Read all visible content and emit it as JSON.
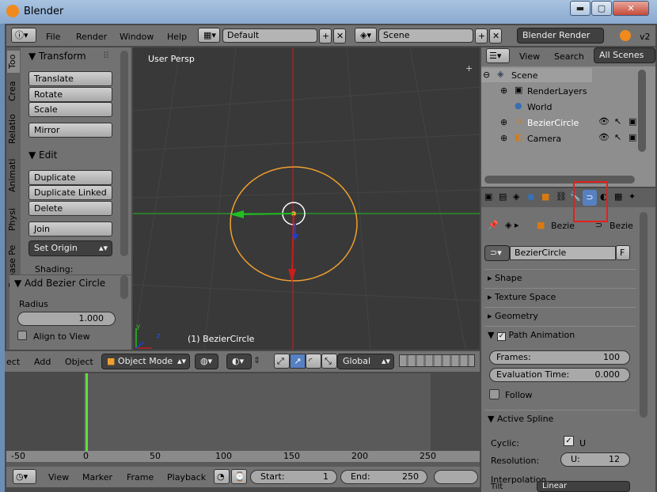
{
  "window": {
    "title": "Blender",
    "min": "▬",
    "max": "▢",
    "close": "✕"
  },
  "infobar": {
    "menus": [
      "File",
      "Render",
      "Window",
      "Help"
    ],
    "layout": "Default",
    "scene": "Scene",
    "engine": "Blender Render",
    "version": "v2"
  },
  "toolshelf": {
    "tabs": [
      "Too",
      "Crea",
      "Relatio",
      "Animati",
      "Physi",
      "Grease Pe"
    ],
    "transform": {
      "title": "Transform",
      "buttons": [
        "Translate",
        "Rotate",
        "Scale",
        "Mirror"
      ]
    },
    "edit": {
      "title": "Edit",
      "buttons": [
        "Duplicate",
        "Duplicate Linked",
        "Delete",
        "Join",
        "Set Origin"
      ],
      "shading": "Shading:"
    }
  },
  "operator": {
    "title": "Add Bezier Circle",
    "radius_label": "Radius",
    "radius_value": "1.000",
    "align": "Align to View"
  },
  "viewport": {
    "label": "User Persp",
    "object": "(1) BezierCircle",
    "axis_y": "y",
    "axis_z": "z"
  },
  "viewheader": {
    "menus": [
      "ect",
      "Add",
      "Object"
    ],
    "mode": "Object Mode",
    "orientation": "Global"
  },
  "timeline": {
    "ticks": [
      "-50",
      "0",
      "50",
      "100",
      "150",
      "200",
      "250"
    ],
    "menus": [
      "View",
      "Marker",
      "Frame",
      "Playback"
    ],
    "start_label": "Start:",
    "start": "1",
    "end_label": "End:",
    "end": "250"
  },
  "outliner": {
    "menus": [
      "View",
      "Search",
      "All Scenes"
    ],
    "items": [
      "Scene",
      "RenderLayers",
      "World",
      "BezierCircle",
      "Camera"
    ]
  },
  "properties": {
    "path1": "Bezie",
    "path2": "Bezie",
    "datablock": "BezierCircle",
    "fake": "F",
    "panels": [
      "Shape",
      "Texture Space",
      "Geometry",
      "Path Animation"
    ],
    "frames_label": "Frames:",
    "frames": "100",
    "eval_label": "Evaluation Time:",
    "eval": "0.000",
    "follow": "Follow",
    "active_spline": "Active Spline",
    "cyclic": "Cyclic:",
    "cyclic_u": "U",
    "resolution": "Resolution:",
    "res_u": "U:",
    "res_value": "12",
    "interp": "Interpolation",
    "tilt": "Tilt",
    "tilt_value": "Linear"
  },
  "colors": {
    "highlight": "#e3211c",
    "curve": "#f0a030",
    "x_axis": "#20c020",
    "y_axis": "#c81e1e"
  }
}
